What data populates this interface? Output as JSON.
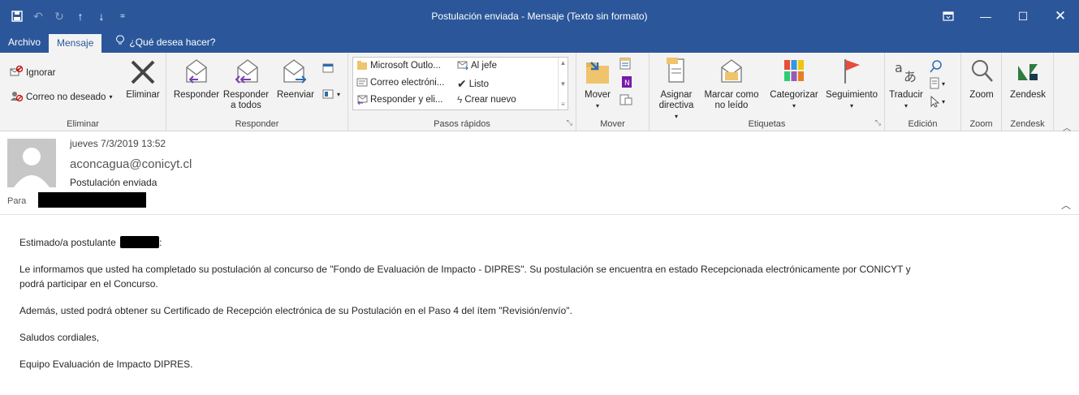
{
  "window": {
    "title": "Postulación enviada - Mensaje (Texto sin formato)"
  },
  "tabs": [
    {
      "label": "Archivo"
    },
    {
      "label": "Mensaje"
    }
  ],
  "tell_me": {
    "label": "¿Qué desea hacer?"
  },
  "ribbon": {
    "eliminar": {
      "ignorar": "Ignorar",
      "correo_no_deseado": "Correo no deseado",
      "eliminar_btn": "Eliminar",
      "group": "Eliminar"
    },
    "responder": {
      "responder": "Responder",
      "responder_todos_1": "Responder",
      "responder_todos_2": "a todos",
      "reenviar": "Reenviar",
      "group": "Responder"
    },
    "pasos_rapidos": {
      "items": [
        "Microsoft Outlo...",
        "Al jefe",
        "Correo electróni...",
        "Listo",
        "Responder y eli...",
        "Crear nuevo"
      ],
      "group": "Pasos rápidos"
    },
    "mover": {
      "mover": "Mover",
      "group": "Mover"
    },
    "etiquetas": {
      "asignar_1": "Asignar",
      "asignar_2": "directiva",
      "marcar_1": "Marcar como",
      "marcar_2": "no leído",
      "categorizar": "Categorizar",
      "seguimiento": "Seguimiento",
      "group": "Etiquetas"
    },
    "edicion": {
      "traducir": "Traducir",
      "group": "Edición"
    },
    "zoom": {
      "zoom": "Zoom",
      "group": "Zoom"
    },
    "zendesk": {
      "zendesk": "Zendesk",
      "group": "Zendesk"
    }
  },
  "header": {
    "date": "jueves 7/3/2019 13:52",
    "from": "aconcagua@conicyt.cl",
    "subject": "Postulación enviada",
    "to_label": "Para"
  },
  "body": {
    "greeting_prefix": "Estimado/a postulante",
    "greeting_suffix": ":",
    "p1_line1": "Le informamos que usted ha completado su postulación al concurso de \"Fondo de Evaluación de Impacto - DIPRES\". Su postulación se encuentra en estado Recepcionada electrónicamente por CONICYT y",
    "p1_line2": "podrá participar en el Concurso.",
    "p2": "Además, usted podrá obtener su Certificado de Recepción electrónica de su Postulación en el Paso 4 del ítem \"Revisión/envío\".",
    "p3": "Saludos cordiales,",
    "p4": "Equipo Evaluación de Impacto DIPRES."
  },
  "colors": {
    "accent": "#2b579a",
    "ribbon_bg": "#f3f3f3"
  }
}
